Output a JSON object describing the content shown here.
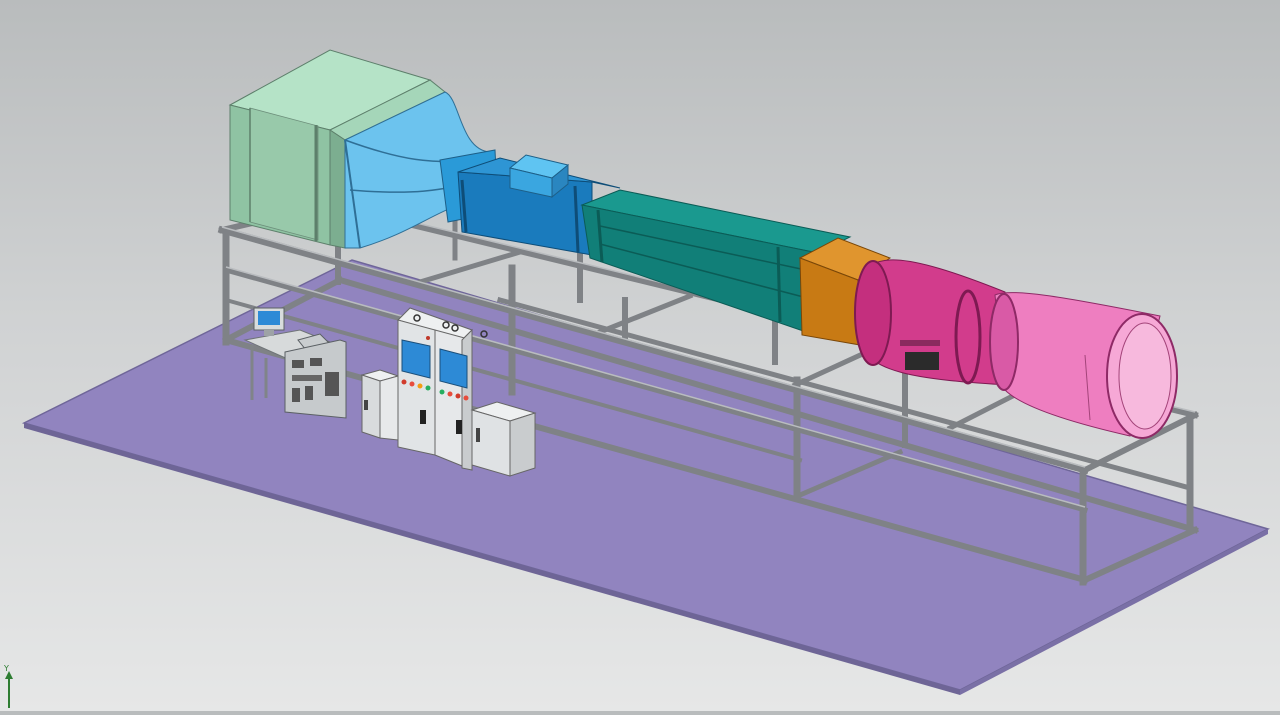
{
  "viewport": {
    "background_top": "#b9bcbd",
    "background_bottom": "#e6e7e7"
  },
  "scene": {
    "floor_color": "#9184bf",
    "frame_color": "#8a8d91",
    "settling_chamber_color": "#9fcfb0",
    "contraction_color": "#5ab4e6",
    "test_section_color": "#1a7bbd",
    "diffuser_color": "#117f78",
    "fan_adapter_color": "#c87a14",
    "fan_duct_color": "#d23c8c",
    "fan_outlet_color": "#ee7ec0",
    "cabinet_color": "#e2e4e5",
    "cabinet_screen_color": "#2d8ad6"
  },
  "triad": {
    "y_label": "Y",
    "y_color": "#2e7d32"
  }
}
